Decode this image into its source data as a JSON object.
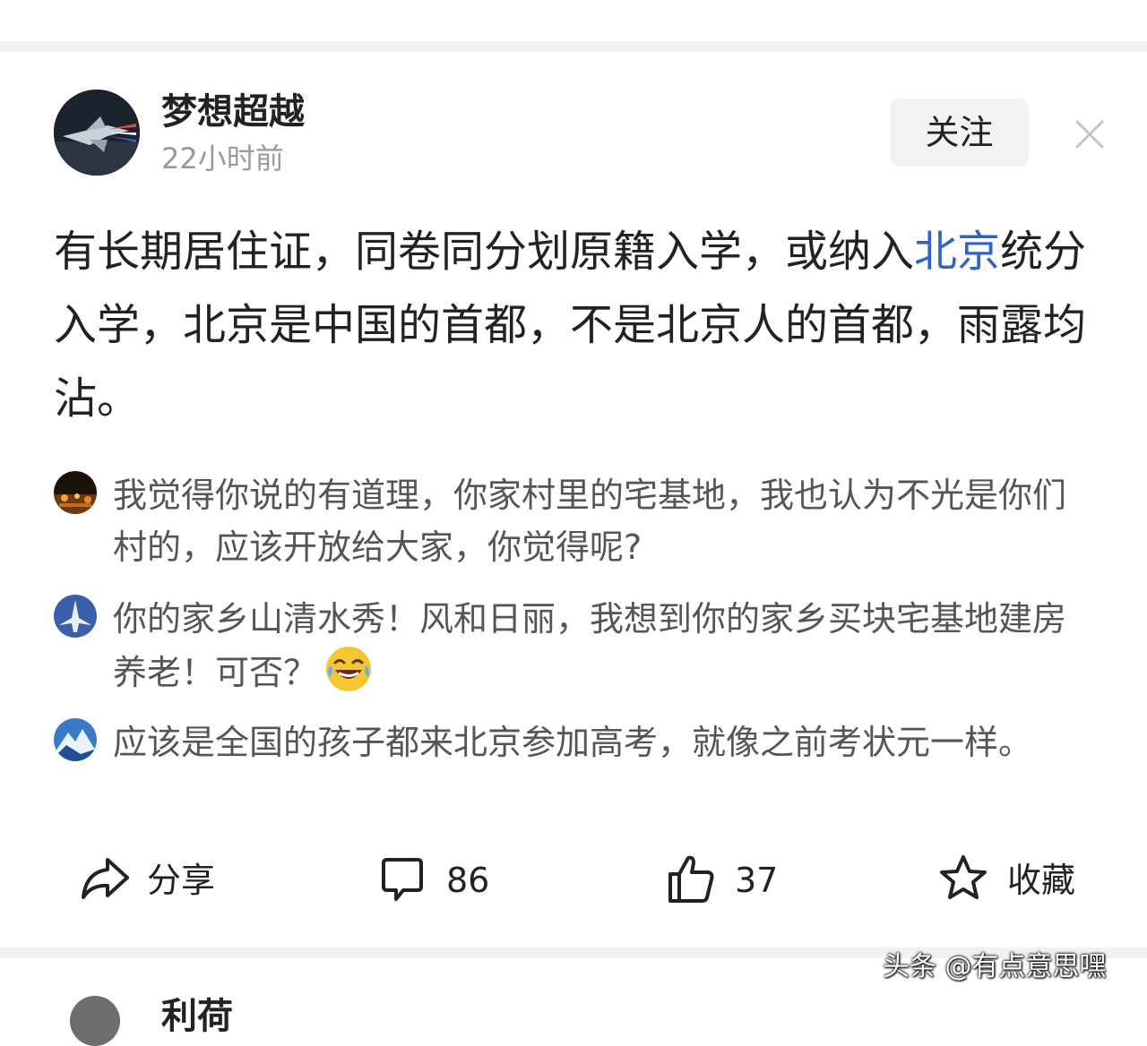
{
  "post": {
    "author": "梦想超越",
    "time": "22小时前",
    "follow_label": "关注",
    "body_before": "有长期居住证，同卷同分划原籍入学，或纳入",
    "body_link": "北京",
    "body_after": "统分入学，北京是中国的首都，不是北京人的首都，雨露均沾。"
  },
  "comments": [
    {
      "text": "我觉得你说的有道理，你家村里的宅基地，我也认为不光是你们村的，应该开放给大家，你觉得呢?",
      "avatar_icon": "night-town-avatar"
    },
    {
      "text": "你的家乡山清水秀！风和日丽，我想到你的家乡买块宅基地建房养老！可否？",
      "avatar_icon": "jet-avatar",
      "emoji": "laughing-tears-emoji"
    },
    {
      "text": "应该是全国的孩子都来北京参加高考，就像之前考状元一样。",
      "avatar_icon": "mountain-avatar"
    }
  ],
  "actions": {
    "share_label": "分享",
    "comment_count": "86",
    "like_count": "37",
    "favorite_label": "收藏"
  },
  "next_post": {
    "author": "利荷"
  },
  "watermark": "头条 @有点意思嘿",
  "colors": {
    "link": "#2f63c7",
    "divider": "#f1f1f1",
    "muted": "#999999",
    "comment_text": "#555555",
    "follow_bg": "#f2f2f2"
  },
  "icons": [
    "close-icon",
    "share-icon",
    "comment-icon",
    "thumbs-up-icon",
    "star-icon"
  ]
}
